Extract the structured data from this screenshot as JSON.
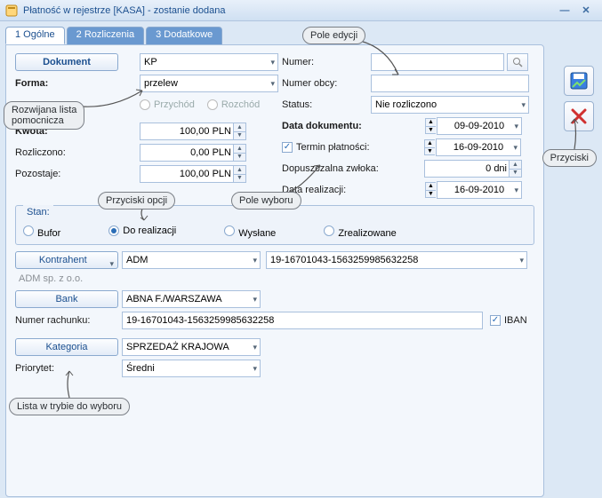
{
  "window": {
    "title": "Płatność w rejestrze [KASA] - zostanie dodana"
  },
  "tabs": {
    "t1": "1 Ogólne",
    "t2": "2 Rozliczenia",
    "t3": "3 Dodatkowe"
  },
  "btnlabels": {
    "dokument": "Dokument",
    "kontrahent": "Kontrahent",
    "bank": "Bank",
    "kategoria": "Kategoria"
  },
  "labels": {
    "forma": "Forma:",
    "kwota": "Kwota:",
    "rozliczono": "Rozliczono:",
    "pozostaje": "Pozostaje:",
    "numer": "Numer:",
    "numer_obcy": "Numer obcy:",
    "status": "Status:",
    "data_dok": "Data dokumentu:",
    "termin": "Termin płatności:",
    "zwloka": "Dopuszczalna zwłoka:",
    "realizacja": "Data realizacji:",
    "stan": "Stan:",
    "bufor": "Bufor",
    "dorealizacji": "Do realizacji",
    "wyslane": "Wysłane",
    "zrealizowane": "Zrealizowane",
    "numer_rach": "Numer rachunku:",
    "iban": "IBAN",
    "priorytet": "Priorytet:",
    "przychod": "Przychód",
    "rozchod": "Rozchód"
  },
  "values": {
    "dokument": "KP",
    "forma": "przelew",
    "kwota": "100,00 PLN",
    "rozliczono": "0,00 PLN",
    "pozostaje": "100,00 PLN",
    "status": "Nie rozliczono",
    "data_dok": "09-09-2010",
    "termin": "16-09-2010",
    "zwloka": "0 dni",
    "realizacja": "16-09-2010",
    "kontrahent": "ADM",
    "konto": "19-16701043-1563259985632258",
    "adm_full": "ADM sp. z o.o.",
    "bank": "ABNA F./WARSZAWA",
    "rachunek": "19-16701043-1563259985632258",
    "kategoria": "SPRZEDAŻ KRAJOWA",
    "priorytet": "Średni"
  },
  "callouts": {
    "pole_edycji": "Pole edycji",
    "przyciski": "Przyciski",
    "rozwijana": "Rozwijana lista\npomocnicza",
    "przyciski_opcji": "Przyciski opcji",
    "pole_wyboru": "Pole wyboru",
    "lista_trybie": "Lista w trybie do wyboru"
  }
}
